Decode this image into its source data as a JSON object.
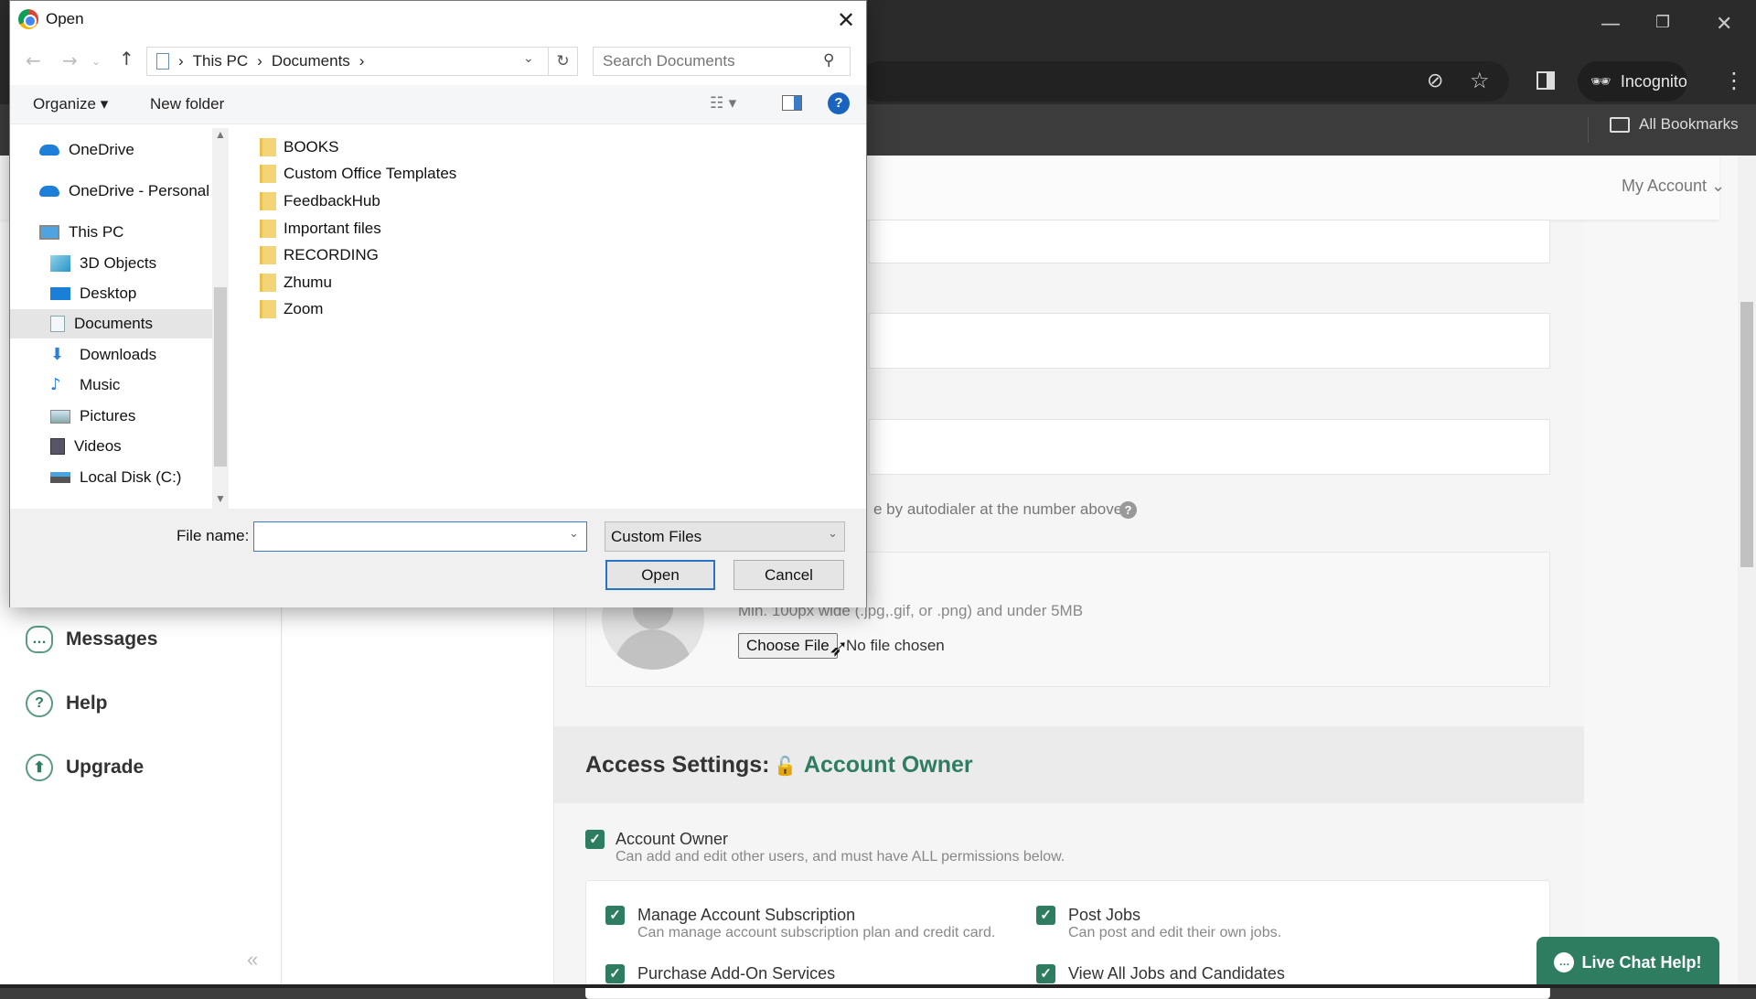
{
  "browser": {
    "window_controls": {
      "minimize": "—",
      "restore": "❐",
      "close": "✕"
    },
    "toolbar_icons": [
      "eye-off-icon",
      "star-icon",
      "side-panel-icon",
      "menu-icon"
    ],
    "incognito_label": "Incognito",
    "bookmarks_label": "All Bookmarks"
  },
  "page": {
    "my_account": "My Account ⌄",
    "sidebar": [
      {
        "label": "Messages",
        "icon": "…"
      },
      {
        "label": "Help",
        "icon": "?"
      },
      {
        "label": "Upgrade",
        "icon": "⬆"
      }
    ],
    "collapse_icon": "«",
    "autodialer_text": "e by autodialer at the number above",
    "autodialer_help": "?",
    "photo_hint": "Min. 100px wide (.jpg,.gif, or .png) and under 5MB",
    "choose_file_label": "Choose File",
    "no_file_text": "No file chosen",
    "access": {
      "title": "Access Settings:",
      "role": "Account Owner",
      "owner": {
        "label": "Account Owner",
        "desc": "Can add and edit other users, and must have ALL permissions below.",
        "checked": true
      },
      "permissions": [
        {
          "label": "Manage Account Subscription",
          "desc": "Can manage account subscription plan and credit card.",
          "checked": true
        },
        {
          "label": "Post Jobs",
          "desc": "Can post and edit their own jobs.",
          "checked": true
        },
        {
          "label": "Purchase Add-On Services",
          "desc": "",
          "checked": true
        },
        {
          "label": "View All Jobs and Candidates",
          "desc": "",
          "checked": true
        }
      ]
    },
    "live_chat_label": "Live Chat Help!"
  },
  "dialog": {
    "title": "Open",
    "close_icon": "✕",
    "breadcrumb": [
      "This PC",
      "Documents"
    ],
    "search_placeholder": "Search Documents",
    "organize_label": "Organize ▾",
    "new_folder_label": "New folder",
    "nav_items": [
      {
        "label": "OneDrive",
        "icon": "cloud",
        "indent": 0
      },
      {
        "label": "OneDrive - Personal",
        "icon": "cloud",
        "indent": 0
      },
      {
        "label": "This PC",
        "icon": "pc",
        "indent": 0
      },
      {
        "label": "3D Objects",
        "icon": "cube",
        "indent": 1
      },
      {
        "label": "Desktop",
        "icon": "desktop",
        "indent": 1
      },
      {
        "label": "Documents",
        "icon": "doc",
        "indent": 1,
        "selected": true
      },
      {
        "label": "Downloads",
        "icon": "download",
        "indent": 1
      },
      {
        "label": "Music",
        "icon": "music",
        "indent": 1
      },
      {
        "label": "Pictures",
        "icon": "pictures",
        "indent": 1
      },
      {
        "label": "Videos",
        "icon": "videos",
        "indent": 1
      },
      {
        "label": "Local Disk (C:)",
        "icon": "disk",
        "indent": 1
      }
    ],
    "files": [
      "BOOKS",
      "Custom Office Templates",
      "FeedbackHub",
      "Important files",
      "RECORDING",
      "Zhumu",
      "Zoom"
    ],
    "file_name_label": "File name:",
    "file_name_value": "",
    "file_type": "Custom Files",
    "open_label": "Open",
    "cancel_label": "Cancel"
  }
}
